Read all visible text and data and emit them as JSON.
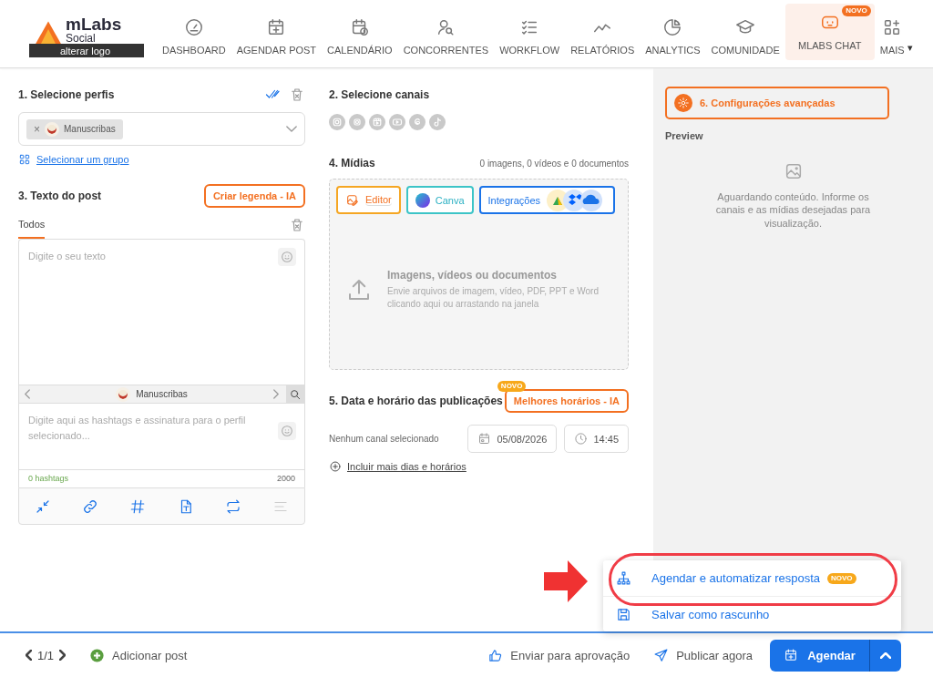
{
  "header": {
    "logo": {
      "name": "mLabs",
      "sub": "Social",
      "action": "alterar logo"
    },
    "nav": [
      {
        "label": "DASHBOARD",
        "kind": "page",
        "selected": false
      },
      {
        "label": "AGENDAR POST",
        "kind": "page",
        "selected": false
      },
      {
        "label": "CALENDÁRIO",
        "kind": "page",
        "selected": false
      },
      {
        "label": "CONCORRENTES",
        "kind": "page",
        "selected": false
      },
      {
        "label": "WORKFLOW",
        "kind": "page",
        "selected": false
      },
      {
        "label": "RELATÓRIOS",
        "kind": "page",
        "selected": false
      },
      {
        "label": "ANALYTICS",
        "kind": "page",
        "selected": false
      },
      {
        "label": "COMUNIDADE",
        "kind": "page",
        "selected": false
      },
      {
        "label": "MLABS CHAT",
        "kind": "page",
        "selected": true,
        "badge": "NOVO"
      },
      {
        "label": "MAIS",
        "kind": "more",
        "selected": false,
        "caret": "▾"
      }
    ]
  },
  "profiles": {
    "title": "1. Selecione perfis",
    "chips": [
      {
        "name": "Manuscribas",
        "remove": "×"
      }
    ],
    "group_link": "Selecionar um grupo"
  },
  "post_text": {
    "title": "3. Texto do post",
    "ai_button": "Criar legenda - IA",
    "tabs": [
      {
        "label": "Todos",
        "selected": true
      }
    ],
    "placeholder": "Digite o seu texto",
    "profile_nav": "Manuscribas",
    "signature_placeholder": "Digite aqui as hashtags e assinatura para o perfil selecionado...",
    "hashtag_count": "0 hashtags",
    "char_limit": "2000",
    "tools": [
      {
        "kind": "collapse",
        "disabled": false
      },
      {
        "kind": "link",
        "disabled": false
      },
      {
        "kind": "hashtag",
        "disabled": false
      },
      {
        "kind": "text-file",
        "disabled": false
      },
      {
        "kind": "repeat",
        "disabled": false
      },
      {
        "kind": "lines",
        "disabled": true
      }
    ]
  },
  "channels": {
    "title": "2. Selecione canais",
    "items": [
      {
        "kind": "instagram",
        "selected": false
      },
      {
        "kind": "instagram-story",
        "selected": false
      },
      {
        "kind": "reels",
        "selected": false
      },
      {
        "kind": "youtube",
        "selected": false
      },
      {
        "kind": "threads",
        "selected": false
      },
      {
        "kind": "tiktok",
        "selected": false
      }
    ]
  },
  "media": {
    "title": "4. Mídias",
    "summary": "0 imagens, 0 vídeos e 0 documentos",
    "buttons": [
      {
        "label": "Editor",
        "kind": "editor"
      },
      {
        "label": "Canva",
        "kind": "canva"
      },
      {
        "label": "Integrações",
        "kind": "integrations"
      }
    ],
    "drop_title": "Imagens, vídeos ou documentos",
    "drop_hint": "Envie arquivos de imagem, vídeo, PDF, PPT e Word clicando aqui ou arrastando na janela"
  },
  "schedule": {
    "title": "5. Data e horário das publicações",
    "ai_button": "Melhores horários - IA",
    "badge": "NOVO",
    "channel_note": "Nenhum canal selecionado",
    "date": "05/08/2026",
    "time": "14:45",
    "add_link": "Incluir mais dias e horários"
  },
  "advanced": {
    "label": "6. Configurações avançadas"
  },
  "preview": {
    "title": "Preview",
    "message": "Aguardando conteúdo. Informe os canais e as mídias desejadas para visualização."
  },
  "footer": {
    "page": "1/1",
    "add_post": "Adicionar post",
    "approval": "Enviar para aprovação",
    "publish_now": "Publicar agora",
    "schedule_button": "Agendar"
  },
  "menu": {
    "items": [
      {
        "label": "Agendar e automatizar resposta",
        "kind": "automate",
        "badge": "NOVO",
        "highlighted": true
      },
      {
        "label": "Salvar como rascunho",
        "kind": "draft",
        "highlighted": false
      }
    ]
  }
}
